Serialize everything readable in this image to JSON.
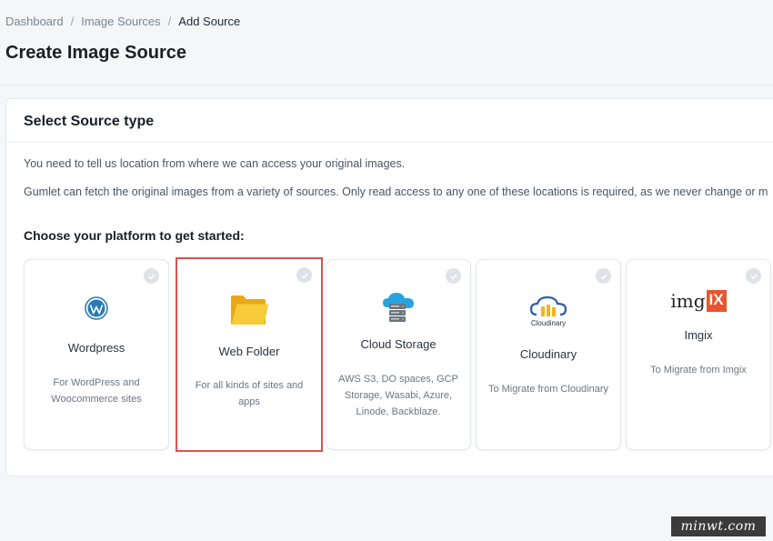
{
  "breadcrumb": {
    "items": [
      "Dashboard",
      "Image Sources",
      "Add Source"
    ],
    "separator": "/"
  },
  "page_title": "Create Image Source",
  "panel": {
    "title": "Select Source type",
    "intro_line1": "You need to tell us location from where we can access your original images.",
    "intro_line2": "Gumlet can fetch the original images from a variety of sources. Only read access to any one of these locations is required, as we never change or m",
    "choose_label": "Choose your platform to get started:"
  },
  "cards": [
    {
      "name": "Wordpress",
      "icon": "wordpress-icon",
      "desc": "For WordPress and Woocommerce sites",
      "selected": false
    },
    {
      "name": "Web Folder",
      "icon": "folder-icon",
      "desc": "For all kinds of sites and apps",
      "selected": true
    },
    {
      "name": "Cloud Storage",
      "icon": "cloud-server-icon",
      "desc": "AWS S3, DO spaces, GCP Storage, Wasabi, Azure, Linode, Backblaze.",
      "selected": false
    },
    {
      "name": "Cloudinary",
      "icon": "cloudinary-logo-icon",
      "logo_text": "Cloudinary",
      "desc": "To Migrate from Cloudinary",
      "selected": false
    },
    {
      "name": "Imgix",
      "icon": "imgix-logo-icon",
      "logo_text": "imgIX",
      "desc": "To Migrate from Imgix",
      "selected": false
    }
  ],
  "colors": {
    "accent_blue": "#2a7ab8",
    "folder_yellow": "#f5c518",
    "selected_border": "#d9534f"
  },
  "watermark": "minwt.com"
}
